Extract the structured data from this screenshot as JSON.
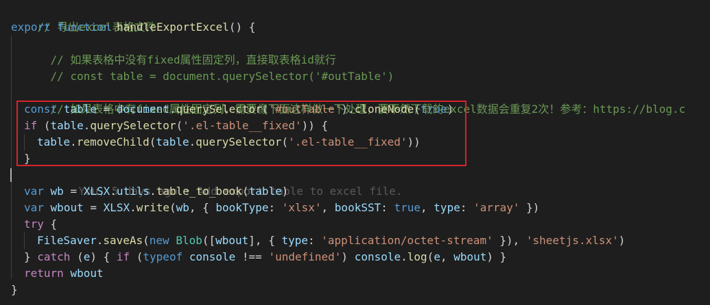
{
  "code": {
    "l1_comment": "// 导出excel表格文件",
    "l2_export": "export",
    "l2_function": "function",
    "l2_name": "handleExportExcel",
    "l2_rest": "() {",
    "l3_comment": "// 如果表格中没有fixed属性固定列，直接取表格id就行",
    "l4_comment": "// const table = document.querySelector('#outTable')",
    "l6_comment": "// 如果表格中有fixed属性固定列，需要像下面这样做一下处理，要不然下载的excel数据会重复2次！参考：https://blog.c",
    "l7_const": "const",
    "l7_table": "table",
    "l7_eq": " = ",
    "l7_document": "document",
    "l7_dot1": ".",
    "l7_qs": "querySelector",
    "l7_open": "(",
    "l7_str": "'#outTable'",
    "l7_close": ").",
    "l7_clone": "cloneNode",
    "l7_open2": "(",
    "l7_true": "true",
    "l7_close2": ")",
    "l8_if": "if",
    "l8_open": " (",
    "l8_table": "table",
    "l8_dot": ".",
    "l8_qs": "querySelector",
    "l8_p": "(",
    "l8_str": "'.el-table__fixed'",
    "l8_close": ")) {",
    "l9_table": "table",
    "l9_dot": ".",
    "l9_rc": "removeChild",
    "l9_p": "(",
    "l9_table2": "table",
    "l9_dot2": ".",
    "l9_qs": "querySelector",
    "l9_p2": "(",
    "l9_str": "'.el-table__fixed'",
    "l9_close": "))",
    "l10_brace": "}",
    "blame": "You, 5 days ago • Add export table to excel file.",
    "l12_var": "var",
    "l12_wb": "wb",
    "l12_eq": " = ",
    "l12_xlsx": "XLSX",
    "l12_dot": ".",
    "l12_utils": "utils",
    "l12_dot2": ".",
    "l12_fn": "table_to_book",
    "l12_p": "(",
    "l12_table": "table",
    "l12_close": ")",
    "l13_var": "var",
    "l13_wbout": "wbout",
    "l13_eq": " = ",
    "l13_xlsx": "XLSX",
    "l13_dot": ".",
    "l13_write": "write",
    "l13_p": "(",
    "l13_wb": "wb",
    "l13_comma": ", { ",
    "l13_booktype": "bookType",
    "l13_colon1": ": ",
    "l13_str1": "'xlsx'",
    "l13_c2": ", ",
    "l13_booksst": "bookSST",
    "l13_colon2": ": ",
    "l13_true": "true",
    "l13_c3": ", ",
    "l13_type": "type",
    "l13_colon3": ": ",
    "l13_str2": "'array'",
    "l13_end": " })",
    "l14_try": "try",
    "l14_brace": " {",
    "l15_fs": "FileSaver",
    "l15_dot": ".",
    "l15_saveas": "saveAs",
    "l15_p": "(",
    "l15_new": "new",
    "l15_sp": " ",
    "l15_blob": "Blob",
    "l15_p2": "([",
    "l15_wbout": "wbout",
    "l15_c": "], { ",
    "l15_type": "type",
    "l15_colon": ": ",
    "l15_str1": "'application/octet-stream'",
    "l15_c2": " }), ",
    "l15_str2": "'sheetjs.xlsx'",
    "l15_end": ")",
    "l16_brace": "} ",
    "l16_catch": "catch",
    "l16_p": " (",
    "l16_e": "e",
    "l16_p2": ") { ",
    "l16_if": "if",
    "l16_p3": " (",
    "l16_typeof": "typeof",
    "l16_sp": " ",
    "l16_console": "console",
    "l16_neq": " !== ",
    "l16_str": "'undefined'",
    "l16_p4": ") ",
    "l16_console2": "console",
    "l16_dot": ".",
    "l16_log": "log",
    "l16_p5": "(",
    "l16_e2": "e",
    "l16_comma": ", ",
    "l16_wbout": "wbout",
    "l16_end": ") }",
    "l17_return": "return",
    "l17_sp": " ",
    "l17_wbout": "wbout",
    "l18_brace": "}"
  }
}
